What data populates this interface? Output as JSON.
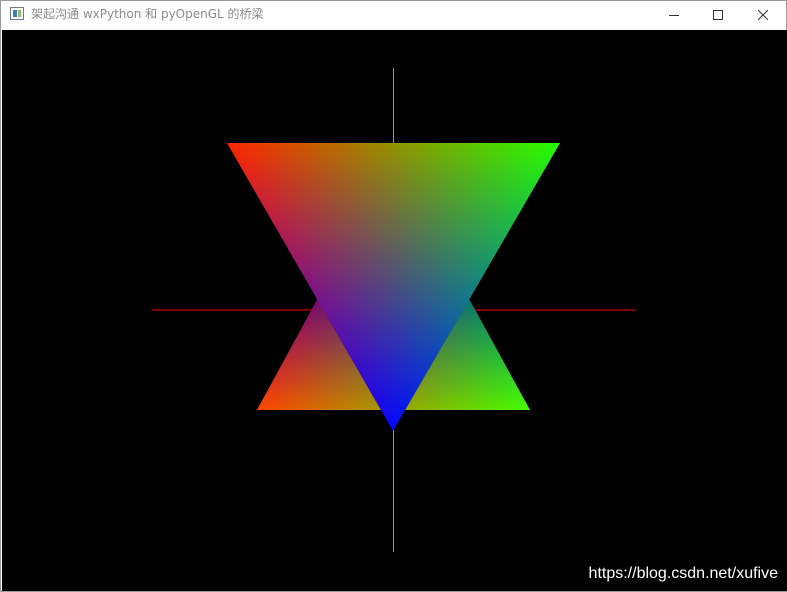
{
  "window": {
    "title": "架起沟通 wxPython 和 pyOpenGL 的桥梁",
    "icon": "wx-app-window-icon",
    "controls": {
      "minimize_icon": "minimize-icon",
      "maximize_icon": "maximize-icon",
      "close_icon": "close-icon"
    }
  },
  "canvas": {
    "background": "#000000",
    "axes": {
      "x_axis_color": "#ff0000",
      "y_axis_color": "#00ff00"
    },
    "triangles": [
      {
        "name": "upright-triangle",
        "vertex_colors": [
          "#ff0000",
          "#00ff00",
          "#0000ff"
        ]
      },
      {
        "name": "inverted-triangle",
        "vertex_colors": [
          "#ff0000",
          "#00ff00",
          "#0000ff"
        ]
      }
    ]
  },
  "watermark": {
    "text": "https://blog.csdn.net/xufive"
  }
}
